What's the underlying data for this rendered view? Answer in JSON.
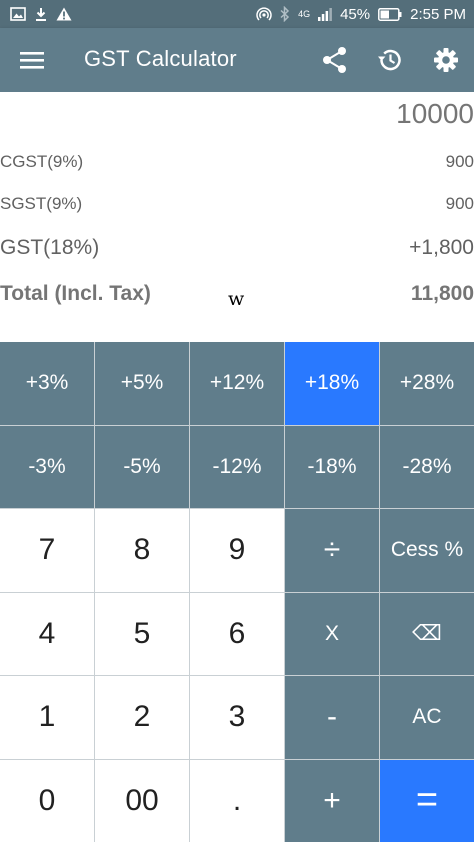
{
  "status_bar": {
    "battery": "45%",
    "time": "2:55 PM",
    "network": "4G"
  },
  "app_bar": {
    "title": "GST Calculator"
  },
  "display": {
    "input_value": "10000",
    "rows": {
      "cgst": {
        "label": "CGST(9%)",
        "value": "900"
      },
      "sgst": {
        "label": "SGST(9%)",
        "value": "900"
      },
      "gst": {
        "label": "GST(18%)",
        "value": "+1,800"
      },
      "total": {
        "label": "Total (Incl. Tax)",
        "value": "11,800"
      }
    },
    "stray_glyph": "w"
  },
  "keypad": {
    "add_3": "+3%",
    "add_5": "+5%",
    "add_12": "+12%",
    "add_18": "+18%",
    "add_28": "+28%",
    "sub_3": "-3%",
    "sub_5": "-5%",
    "sub_12": "-12%",
    "sub_18": "-18%",
    "sub_28": "-28%",
    "seven": "7",
    "eight": "8",
    "nine": "9",
    "divide": "÷",
    "cess": "Cess %",
    "four": "4",
    "five": "5",
    "six": "6",
    "multiply": "X",
    "backspace": "⌫",
    "one": "1",
    "two": "2",
    "three": "3",
    "minus": "-",
    "clear": "AC",
    "zero": "0",
    "double_zero": "00",
    "decimal": ".",
    "plus": "+",
    "equals": "="
  },
  "colors": {
    "primary": "#607d8b",
    "status": "#546e7a",
    "accent": "#2979ff"
  }
}
